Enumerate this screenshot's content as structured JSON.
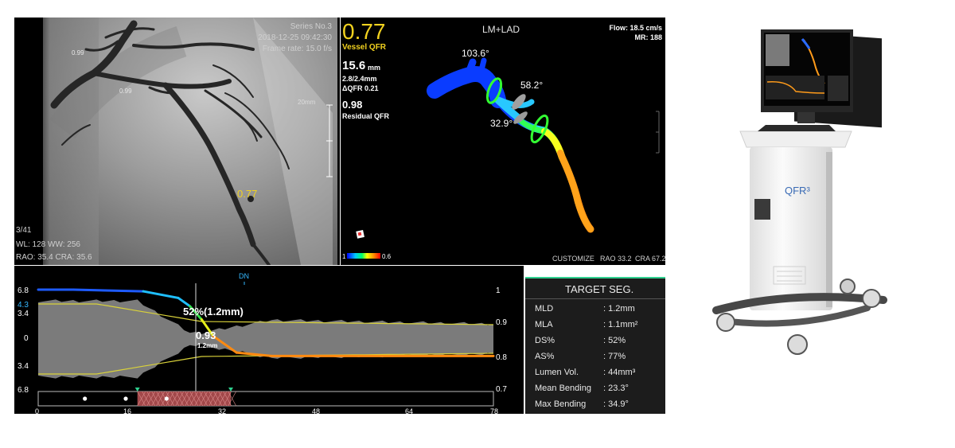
{
  "angio": {
    "series": "Series No.3",
    "datetime": "2018-12-25 09:42:30",
    "frame_rate": "Frame rate: 15.0 f/s",
    "frame_counter": "3/41",
    "wl_ww": "WL: 128 WW: 256",
    "angles": "RAO: 35.4 CRA: 35.6",
    "qfr_marker": "0.77",
    "scale_label": "20mm",
    "small_labels": [
      "0.99",
      "0.99"
    ]
  },
  "qfr": {
    "value": "0.77",
    "value_label": "Vessel QFR",
    "length": "15.6",
    "length_unit": "mm",
    "diameter": "2.8/2.4mm",
    "delta": "ΔQFR  0.21",
    "residual": "0.98",
    "residual_label": "Residual QFR"
  },
  "model": {
    "title": "LM+LAD",
    "flow": "Flow: 18.5 cm/s",
    "mr": "MR: 188",
    "angle_top": "103.6°",
    "angle_mid": "58.2°",
    "angle_bottom": "32.9°",
    "color_bar_min": "1",
    "color_bar_max": "0.6",
    "footer_customize": "CUSTOMIZE",
    "footer_rao": "RAO 33.2",
    "footer_cra": "CRA 67.2",
    "colors": {
      "ramp": [
        "#0000ff",
        "#00c8ff",
        "#00ff66",
        "#ffff00",
        "#ff8c00",
        "#ff0000"
      ]
    }
  },
  "profile": {
    "dn_label": "DN",
    "left_ticks": [
      "6.8",
      "4.3",
      "3.4",
      "0",
      "3.4",
      "6.8"
    ],
    "right_ticks": [
      "1",
      "0.9",
      "0.8",
      "0.7"
    ],
    "x_ticks": [
      "0",
      "16",
      "32",
      "48",
      "64",
      "78"
    ],
    "stenosis_label": "52%(1.2mm)",
    "cursor_qfr": "0.93",
    "cursor_diam": "1.2mm"
  },
  "chart_data": {
    "type": "line",
    "x_range": [
      0,
      78
    ],
    "y_left_range": [
      -6.8,
      6.8
    ],
    "y_right_range": [
      0.7,
      1.0
    ],
    "series": [
      {
        "x": [
          0,
          6,
          18,
          24,
          26,
          28,
          30,
          34,
          40,
          78
        ],
        "y": [
          1.0,
          1.0,
          0.995,
          0.975,
          0.95,
          0.91,
          0.86,
          0.81,
          0.8,
          0.8
        ]
      }
    ],
    "cursor_x": 27,
    "lesion_range": [
      17,
      33
    ],
    "markers_x": [
      8,
      15,
      22
    ]
  },
  "target_seg": {
    "title": "TARGET SEG.",
    "rows": [
      {
        "label": "MLD",
        "value": ": 1.2mm"
      },
      {
        "label": "MLA",
        "value": ": 1.1mm²"
      },
      {
        "label": "DS%",
        "value": ": 52%"
      },
      {
        "label": "AS%",
        "value": ": 77%"
      },
      {
        "label": "Lumen Vol.",
        "value": ": 44mm³"
      },
      {
        "label": "Mean Bending",
        "value": ": 23.3°"
      },
      {
        "label": "Max Bending",
        "value": ": 34.9°"
      }
    ]
  },
  "device": {
    "brand": "QFR³"
  }
}
